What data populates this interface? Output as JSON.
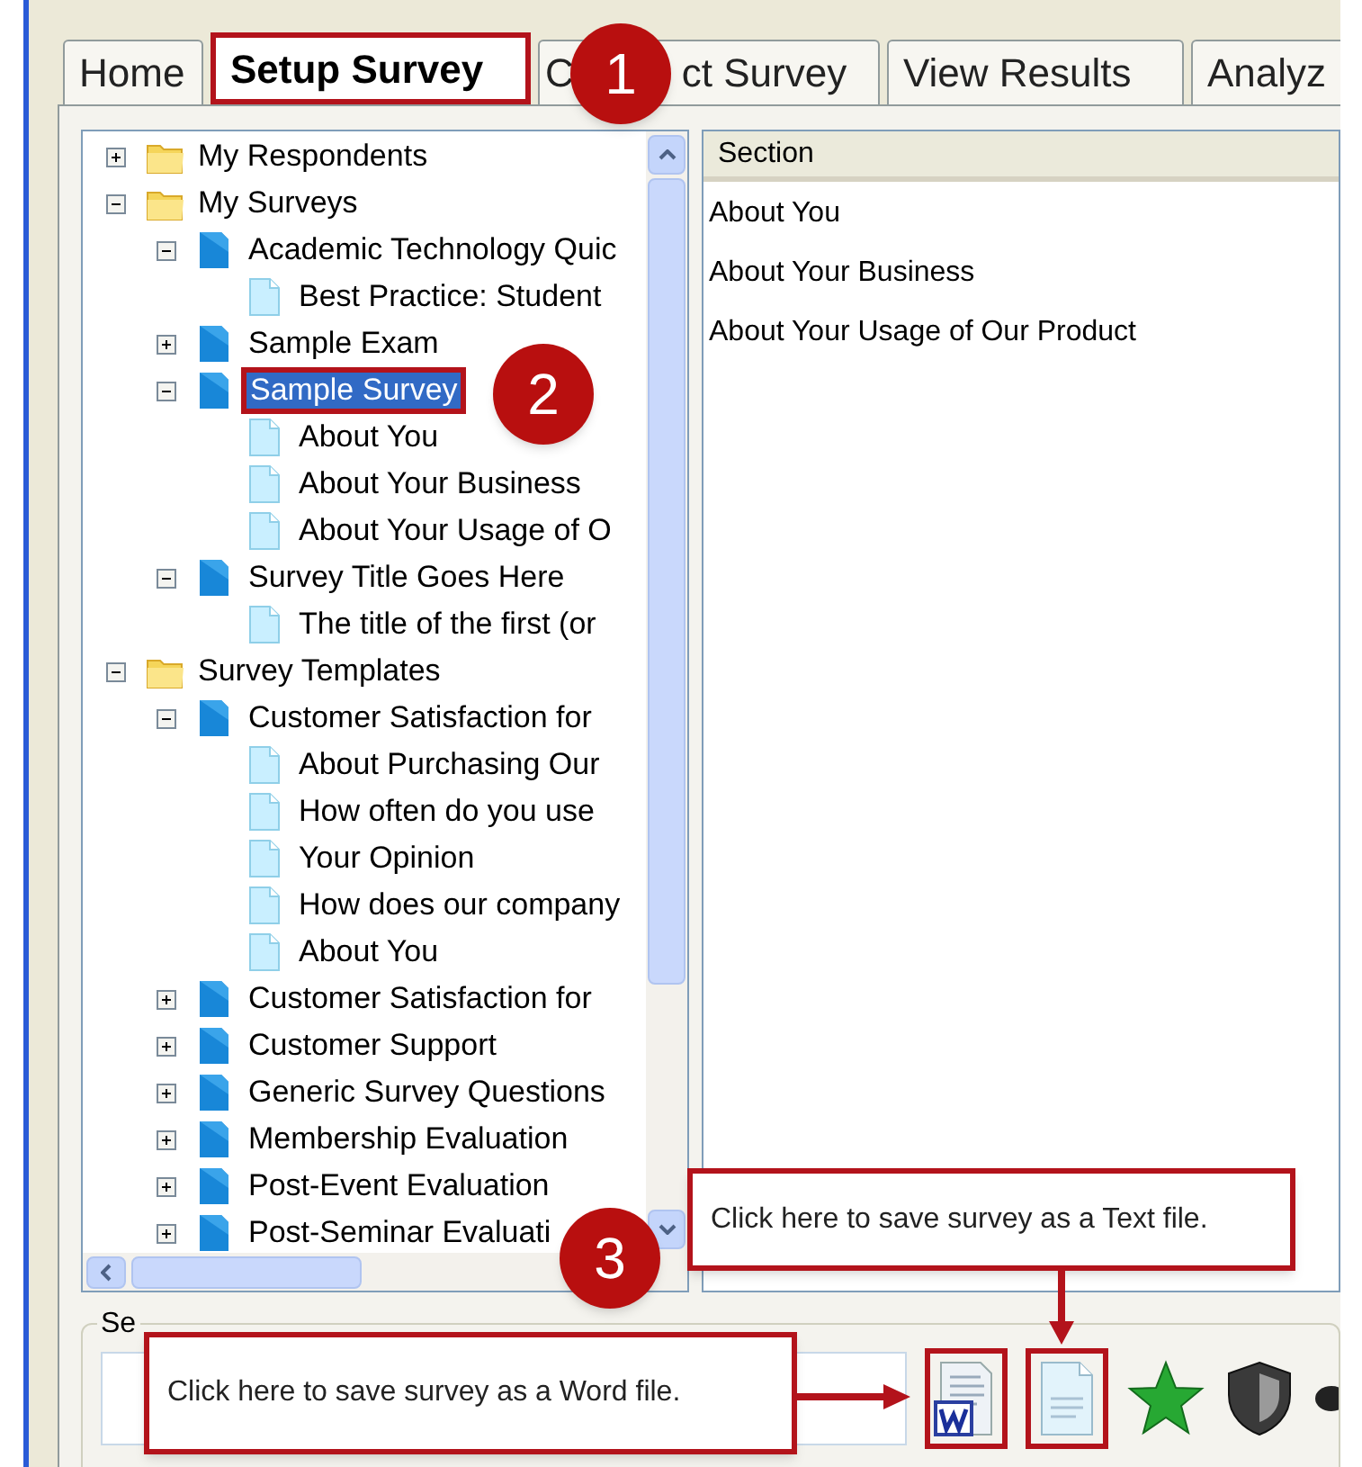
{
  "tabs": [
    {
      "label": "Home",
      "selected": false
    },
    {
      "label": "Setup Survey",
      "selected": true,
      "annotated": true
    },
    {
      "label_parts": [
        "C",
        "ct Survey"
      ],
      "selected": false
    },
    {
      "label": "View Results",
      "selected": false
    },
    {
      "label": "Analyz",
      "selected": false
    }
  ],
  "tree": [
    {
      "label": "My Respondents",
      "kind": "folder",
      "selected": false,
      "expanded": false
    },
    {
      "label": "My Surveys",
      "kind": "folder",
      "selected": false,
      "expanded": true,
      "children": [
        {
          "label": "Academic Technology Quic",
          "kind": "survey",
          "selected": false,
          "expanded": true,
          "children": [
            {
              "label": "Best Practice: Student",
              "kind": "page",
              "selected": false
            }
          ]
        },
        {
          "label": "Sample Exam",
          "kind": "survey",
          "selected": false,
          "expanded": false
        },
        {
          "label": "Sample Survey",
          "kind": "survey",
          "selected": true,
          "annotated": true,
          "expanded": true,
          "children": [
            {
              "label": "About You",
              "kind": "page",
              "selected": false
            },
            {
              "label": "About Your Business",
              "kind": "page",
              "selected": false
            },
            {
              "label": "About Your Usage of O",
              "kind": "page",
              "selected": false
            }
          ]
        },
        {
          "label": "Survey Title Goes Here",
          "kind": "survey",
          "selected": false,
          "expanded": true,
          "children": [
            {
              "label": "The title of the first (or",
              "kind": "page",
              "selected": false
            }
          ]
        }
      ]
    },
    {
      "label": "Survey Templates",
      "kind": "folder",
      "selected": false,
      "expanded": true,
      "children": [
        {
          "label": "Customer Satisfaction for",
          "kind": "survey",
          "selected": false,
          "expanded": true,
          "children": [
            {
              "label": "About Purchasing Our",
              "kind": "page",
              "selected": false
            },
            {
              "label": "How often do you use",
              "kind": "page",
              "selected": false
            },
            {
              "label": "Your Opinion",
              "kind": "page",
              "selected": false
            },
            {
              "label": "How does our company",
              "kind": "page",
              "selected": false
            },
            {
              "label": "About You",
              "kind": "page",
              "selected": false
            }
          ]
        },
        {
          "label": "Customer Satisfaction for",
          "kind": "survey",
          "selected": false,
          "expanded": false
        },
        {
          "label": "Customer Support",
          "kind": "survey",
          "selected": false,
          "expanded": false
        },
        {
          "label": "Generic Survey Questions",
          "kind": "survey",
          "selected": false,
          "expanded": false
        },
        {
          "label": "Membership Evaluation",
          "kind": "survey",
          "selected": false,
          "expanded": false
        },
        {
          "label": "Post-Event Evaluation",
          "kind": "survey",
          "selected": false,
          "expanded": false
        },
        {
          "label": "Post-Seminar Evaluati",
          "kind": "survey",
          "selected": false,
          "expanded": false
        }
      ]
    }
  ],
  "section_list": {
    "header": "Section",
    "rows": [
      "About You",
      "About Your Business",
      "About Your Usage of Our Product"
    ]
  },
  "bottom_group": {
    "label": "Se",
    "tools": [
      {
        "kind": "word",
        "annotated": true
      },
      {
        "kind": "text",
        "annotated": true
      },
      {
        "kind": "star",
        "annotated": false
      },
      {
        "kind": "shield",
        "annotated": false
      },
      {
        "kind": "round",
        "annotated": false
      }
    ]
  },
  "annotations": {
    "badges": [
      "1",
      "2",
      "3"
    ],
    "callouts": [
      "Click here to save survey as a Text file.",
      "Click here to save survey as a Word file."
    ]
  }
}
